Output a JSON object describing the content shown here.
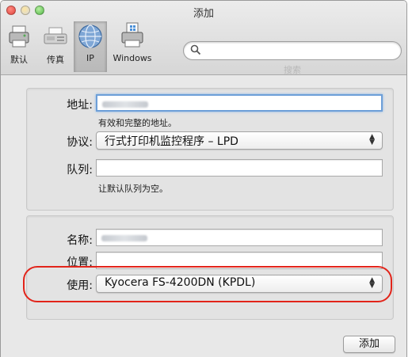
{
  "window": {
    "title": "添加"
  },
  "toolbar": {
    "items": [
      {
        "label": "默认",
        "icon": "printer-default-icon",
        "selected": false
      },
      {
        "label": "传真",
        "icon": "fax-icon",
        "selected": false
      },
      {
        "label": "IP",
        "icon": "ip-globe-icon",
        "selected": true
      },
      {
        "label": "Windows",
        "icon": "windows-printer-icon",
        "selected": false
      }
    ],
    "search": {
      "value": "",
      "caption": "搜索"
    }
  },
  "form": {
    "address": {
      "label": "地址:",
      "value": "",
      "hint": "有效和完整的地址。"
    },
    "protocol": {
      "label": "协议:",
      "value": "行式打印机监控程序 – LPD"
    },
    "queue": {
      "label": "队列:",
      "value": "",
      "hint": "让默认队列为空。"
    },
    "name": {
      "label": "名称:",
      "value": ""
    },
    "location": {
      "label": "位置:",
      "value": ""
    },
    "use": {
      "label": "使用:",
      "value": "Kyocera FS-4200DN (KPDL)"
    }
  },
  "buttons": {
    "add": "添加"
  },
  "colors": {
    "highlight": "#e2241a",
    "focus": "#6d9fd8"
  }
}
